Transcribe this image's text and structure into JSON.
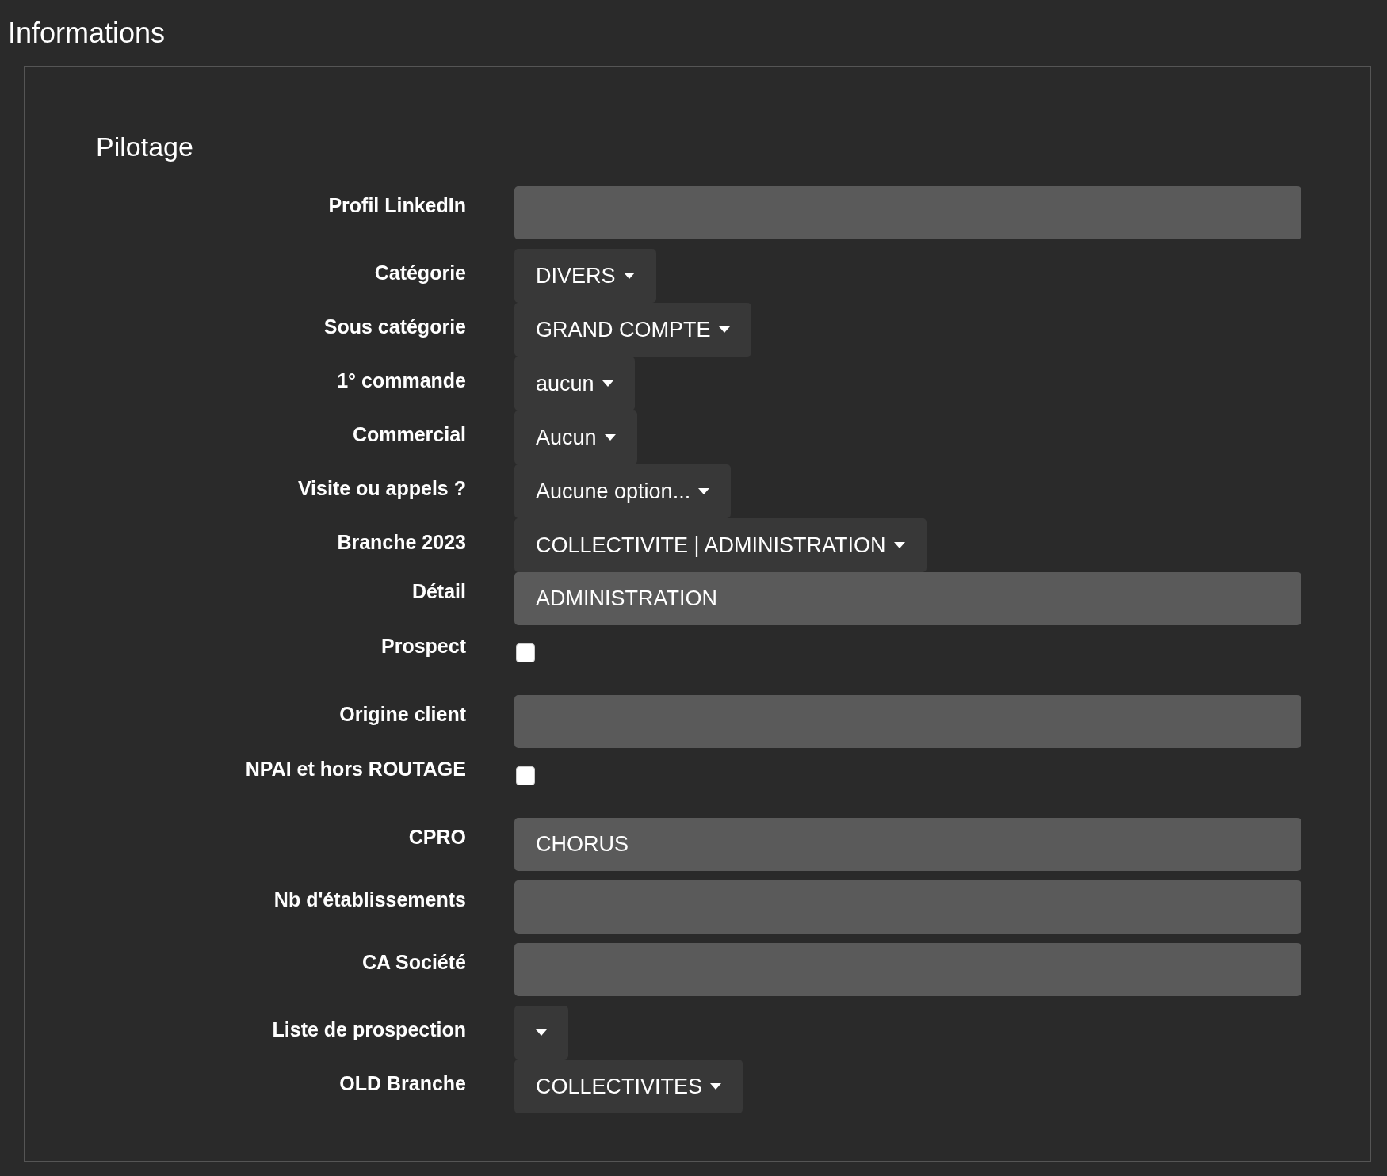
{
  "title": "Informations",
  "section": {
    "title": "Pilotage",
    "fields": [
      {
        "kind": "input",
        "label": "Profil LinkedIn"
      },
      {
        "kind": "dropdown",
        "label": "Catégorie",
        "value": "DIVERS"
      },
      {
        "kind": "dropdown",
        "label": "Sous catégorie",
        "value": "GRAND COMPTE"
      },
      {
        "kind": "dropdown",
        "label": "1° commande",
        "value": "aucun"
      },
      {
        "kind": "dropdown",
        "label": "Commercial",
        "value": "Aucun"
      },
      {
        "kind": "dropdown",
        "label": "Visite ou appels ?",
        "value": "Aucune option..."
      },
      {
        "kind": "dropdown",
        "label": "Branche 2023",
        "value": "COLLECTIVITE | ADMINISTRATION"
      },
      {
        "kind": "input",
        "label": "Détail",
        "value": "ADMINISTRATION"
      },
      {
        "kind": "checkbox",
        "label": "Prospect",
        "checked": false
      },
      {
        "kind": "input",
        "label": "Origine client"
      },
      {
        "kind": "checkbox",
        "label": "NPAI et hors ROUTAGE",
        "checked": false
      },
      {
        "kind": "input",
        "label": "CPRO",
        "value": "CHORUS"
      },
      {
        "kind": "input",
        "label": "Nb d'établissements"
      },
      {
        "kind": "input",
        "label": "CA Société"
      },
      {
        "kind": "dropdown",
        "label": "Liste de prospection"
      },
      {
        "kind": "dropdown",
        "label": "OLD Branche",
        "value": "COLLECTIVITES"
      }
    ]
  }
}
